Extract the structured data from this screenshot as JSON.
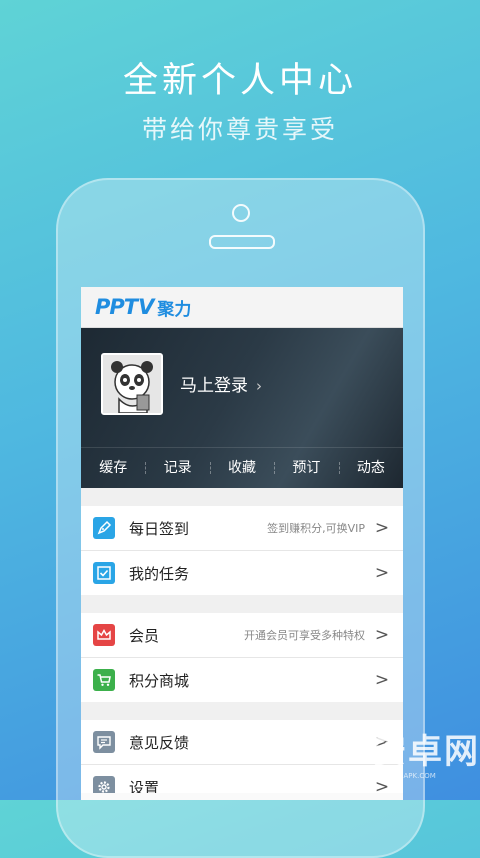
{
  "hero": {
    "title": "全新个人中心",
    "subtitle": "带给你尊贵享受"
  },
  "app": {
    "logo_pp": "PP",
    "logo_tv": "TV",
    "logo_name": "聚力"
  },
  "profile": {
    "login_label": "马上登录",
    "chevron": "›",
    "tabs": [
      "缓存",
      "记录",
      "收藏",
      "预订",
      "动态"
    ]
  },
  "menu": {
    "groups": [
      [
        {
          "label": "每日签到",
          "hint": "签到赚积分,可换VIP",
          "icon": "pen-sign-icon",
          "color": "#2aa5e6"
        },
        {
          "label": "我的任务",
          "hint": "",
          "icon": "checkbox-task-icon",
          "color": "#2aa5e6"
        }
      ],
      [
        {
          "label": "会员",
          "hint": "开通会员可享受多种特权",
          "icon": "crown-icon",
          "color": "#e54545"
        },
        {
          "label": "积分商城",
          "hint": "",
          "icon": "cart-icon",
          "color": "#3cb04b"
        }
      ],
      [
        {
          "label": "意见反馈",
          "hint": "",
          "icon": "feedback-icon",
          "color": "#7d8fa0"
        },
        {
          "label": "设置",
          "hint": "",
          "icon": "gear-icon",
          "color": "#7d8fa0"
        }
      ]
    ],
    "chevron": ">"
  },
  "watermark": {
    "text": "安卓网",
    "url": "WWW.HIAPK.COM"
  }
}
